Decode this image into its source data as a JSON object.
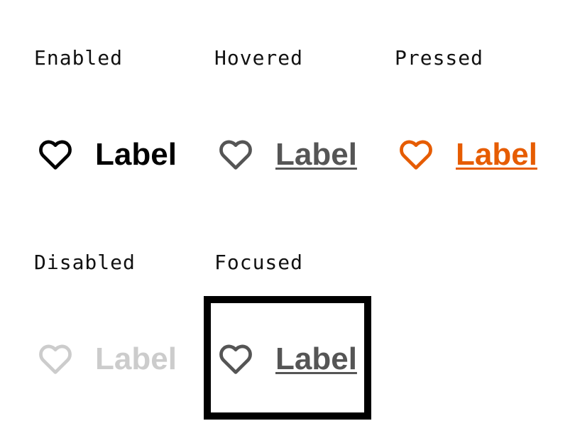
{
  "colors": {
    "enabled": "#000000",
    "hovered": "#555555",
    "pressed": "#e65c00",
    "disabled": "#cccccc",
    "focused": "#555555",
    "focus_ring": "#000000"
  },
  "icon": "heart-outline-icon",
  "states": {
    "enabled": {
      "title": "Enabled",
      "button_label": "Label"
    },
    "hovered": {
      "title": "Hovered",
      "button_label": "Label"
    },
    "pressed": {
      "title": "Pressed",
      "button_label": "Label"
    },
    "disabled": {
      "title": "Disabled",
      "button_label": "Label"
    },
    "focused": {
      "title": "Focused",
      "button_label": "Label"
    }
  }
}
